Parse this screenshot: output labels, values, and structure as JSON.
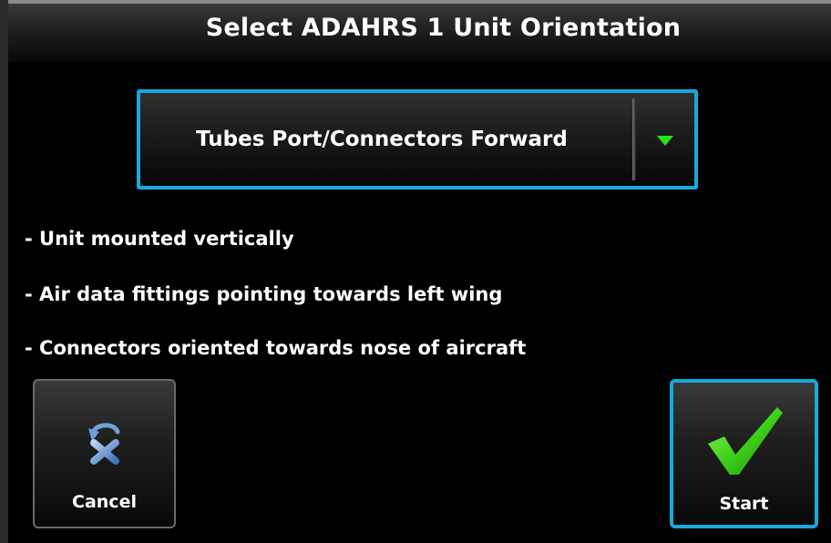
{
  "title": "Select ADAHRS 1 Unit Orientation",
  "orientation_select": {
    "value": "Tubes Port/Connectors Forward",
    "arrow_icon": "triangle-down-icon"
  },
  "description": [
    "- Unit mounted vertically",
    "- Air data fittings pointing towards left wing",
    "- Connectors oriented towards nose of aircraft"
  ],
  "buttons": {
    "cancel": {
      "label": "Cancel",
      "icon": "cancel-undo-icon"
    },
    "start": {
      "label": "Start",
      "icon": "checkmark-icon"
    }
  },
  "colors": {
    "highlight": "#19a9dc",
    "arrow": "#1ee61e",
    "check": "#3ed21a",
    "cancel_x": "#6ea0d8",
    "text": "#ffffff",
    "background": "#000000"
  }
}
